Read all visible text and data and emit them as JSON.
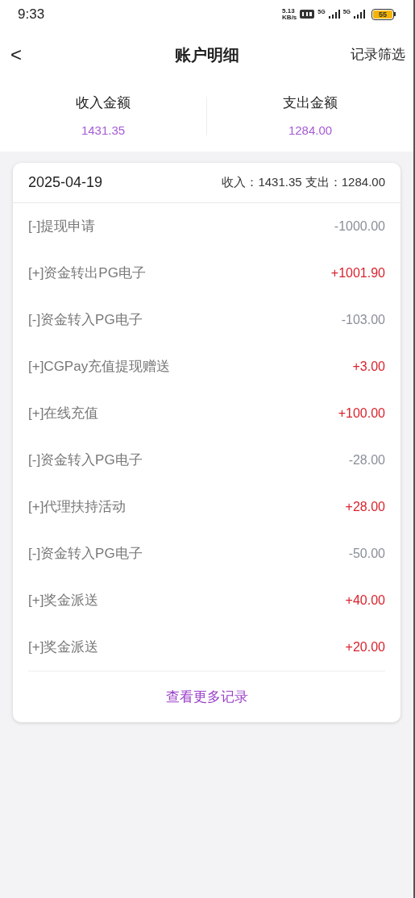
{
  "status_bar": {
    "time": "9:33",
    "speed_value": "5.13",
    "speed_unit": "KB/s",
    "network_1": "5G",
    "network_2": "5G",
    "battery": "55"
  },
  "nav": {
    "back": "<",
    "title": "账户明细",
    "action": "记录筛选"
  },
  "summary": [
    {
      "label": "收入金额",
      "value": "1431.35"
    },
    {
      "label": "支出金额",
      "value": "1284.00"
    }
  ],
  "day": {
    "date": "2025-04-19",
    "totals": "收入：1431.35 支出：1284.00",
    "records": [
      {
        "kind": "expense",
        "name": "[-]提现申请",
        "amount": "-1000.00"
      },
      {
        "kind": "income",
        "name": "[+]资金转出PG电子",
        "amount": "+1001.90"
      },
      {
        "kind": "expense",
        "name": "[-]资金转入PG电子",
        "amount": "-103.00"
      },
      {
        "kind": "income",
        "name": "[+]CGPay充值提现赠送",
        "amount": "+3.00"
      },
      {
        "kind": "income",
        "name": "[+]在线充值",
        "amount": "+100.00"
      },
      {
        "kind": "expense",
        "name": "[-]资金转入PG电子",
        "amount": "-28.00"
      },
      {
        "kind": "income",
        "name": "[+]代理扶持活动",
        "amount": "+28.00"
      },
      {
        "kind": "expense",
        "name": "[-]资金转入PG电子",
        "amount": "-50.00"
      },
      {
        "kind": "income",
        "name": "[+]奖金派送",
        "amount": "+40.00"
      },
      {
        "kind": "income",
        "name": "[+]奖金派送",
        "amount": "+20.00"
      }
    ],
    "more": "查看更多记录"
  }
}
